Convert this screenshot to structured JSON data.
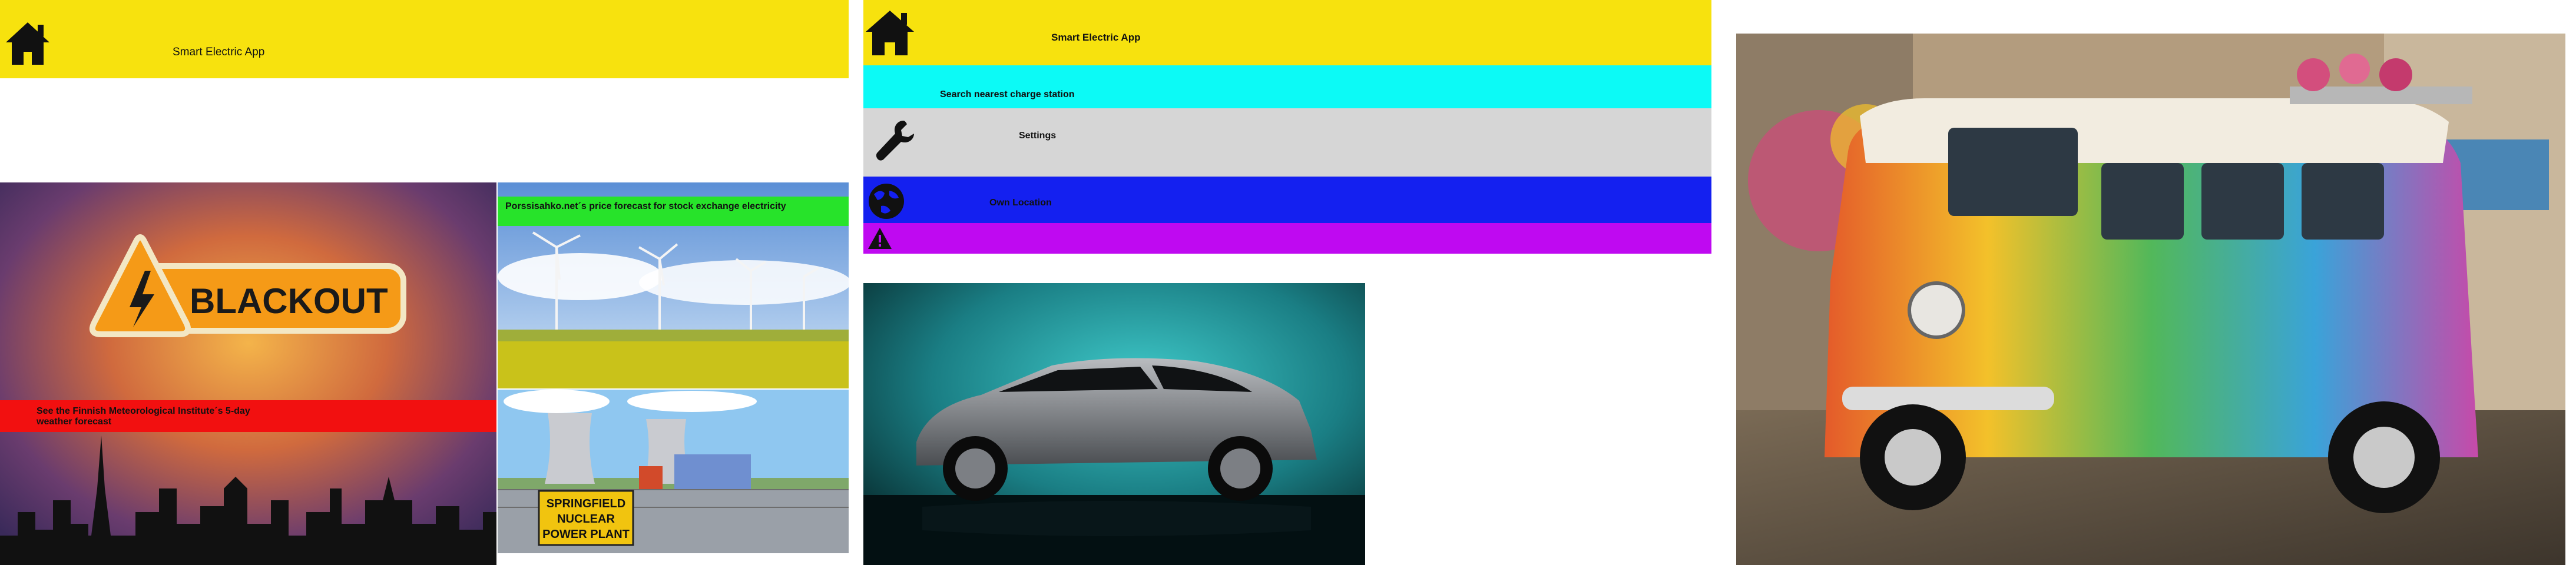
{
  "panel1": {
    "header": {
      "title": "Smart Electric App",
      "home_icon": "home-icon"
    },
    "blackout_image": {
      "badge_text": "BLACKOUT",
      "icon": "lightning-icon"
    },
    "weather_link": {
      "label": "See the Finnish Meteorological Institute´s 5-day weather forecast"
    },
    "price_link": {
      "label": "Porssisahko.net´s price forecast for stock exchange electricity"
    },
    "nuclear_sign": {
      "line1": "SPRINGFIELD",
      "line2": "NUCLEAR",
      "line3": "POWER PLANT"
    }
  },
  "panel2": {
    "header": {
      "title": "Smart Electric App",
      "home_icon": "home-icon"
    },
    "menu": {
      "search": "Search nearest charge station",
      "settings": "Settings",
      "location": "Own Location"
    },
    "icons": {
      "settings": "wrench-icon",
      "location": "globe-icon",
      "alert": "warning-icon"
    }
  },
  "colors": {
    "header": "#F7E20E",
    "search_row": "#0CFAF6",
    "settings_row": "#D6D6D6",
    "location_row": "#1420F0",
    "alert_row": "#BF09F1",
    "weather_bar": "#F21010",
    "price_bar": "#27E32A"
  }
}
